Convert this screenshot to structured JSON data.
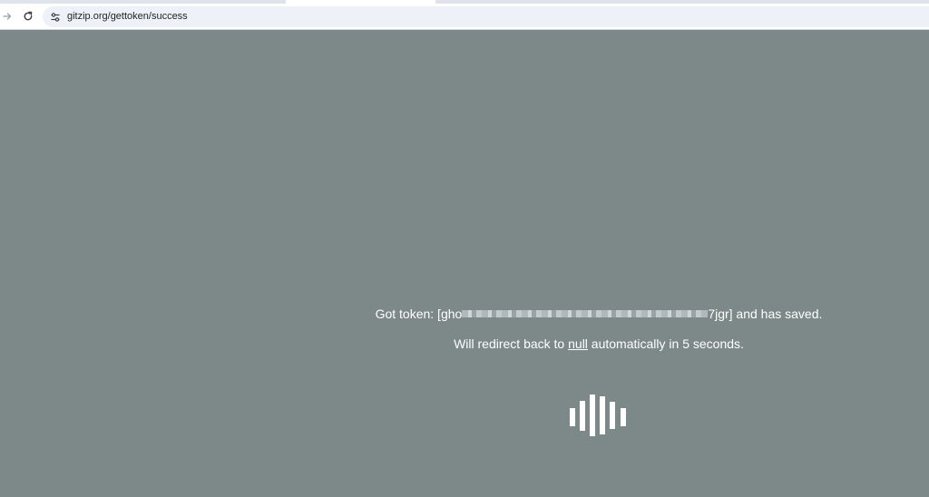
{
  "browser": {
    "url": "gitzip.org/gettoken/success",
    "icons": {
      "forward": "arrow-right-icon",
      "reload": "reload-icon",
      "site_info": "tune-icon"
    }
  },
  "message": {
    "token_prefix": "Got token: [gho",
    "token_suffix": "7jgr] and has saved.",
    "redirect_before": "Will redirect back to ",
    "redirect_link": "null",
    "redirect_after": " automatically in 5 seconds."
  },
  "loader": {
    "icon": "loading-bars-icon"
  },
  "colors": {
    "page_background": "#7d8988",
    "text": "#ffffff"
  }
}
